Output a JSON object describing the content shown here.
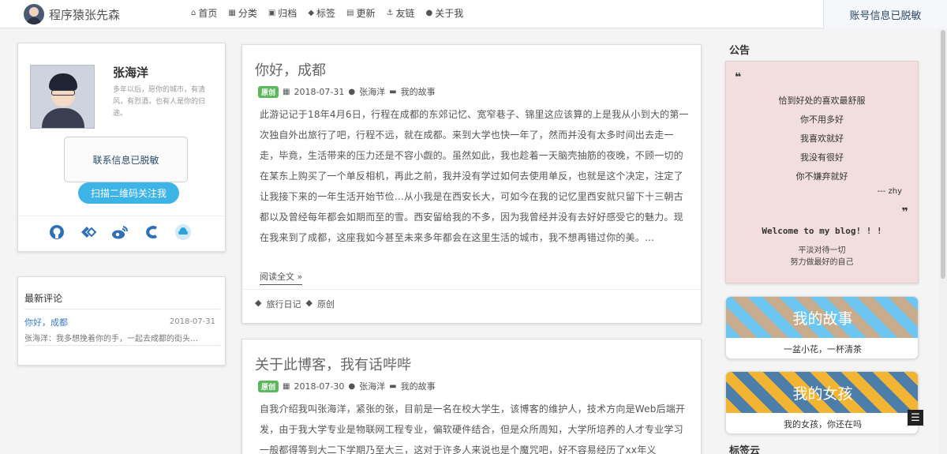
{
  "header": {
    "brand": "程序猿张先森",
    "nav": [
      {
        "icon": "home-icon",
        "glyph": "⌂",
        "label": "首页"
      },
      {
        "icon": "grid-icon",
        "glyph": "▦",
        "label": "分类"
      },
      {
        "icon": "archive-icon",
        "glyph": "▣",
        "label": "归档"
      },
      {
        "icon": "tags-icon",
        "glyph": "◆",
        "label": "标签"
      },
      {
        "icon": "calendar-plus-icon",
        "glyph": "▤",
        "label": "更新"
      },
      {
        "icon": "anchor-icon",
        "glyph": "⚓",
        "label": "友链"
      },
      {
        "icon": "user-icon",
        "glyph": "●",
        "label": "关于我"
      }
    ],
    "account": "账号信息已脱敏"
  },
  "profile": {
    "name": "张海洋",
    "bio": "多年以后，愿你的城市，有清风，有烈酒，也有人是你的归途。",
    "contact": "联系信息已脱敏",
    "qr_button": "扫描二维码关注我"
  },
  "comments": {
    "title": "最新评论",
    "items": [
      {
        "post": "你好，成都",
        "date": "2018-07-31",
        "text": "张海洋：我多想挽着你的手，一起去成都的街头…"
      }
    ]
  },
  "posts": [
    {
      "title": "你好，成都",
      "badge": "原创",
      "date": "2018-07-31",
      "author": "张海洋",
      "category": "我的故事",
      "excerpt": "此游记记于18年4月6日，行程在成都的东郊记忆、宽窄巷子、锦里这应该算的上是我从小到大的第一次独自外出旅行了吧，行程不远，就在成都。来到大学也快一年了，然而并没有太多时间出去走一走，毕竟，生活带来的压力还是不容小觑的。虽然如此，我也趁着一天脑壳抽筋的夜晚，不顾一切的在某东上购买了一个单反相机，再此之前，我并没有学过如何去使用单反，也就是这个决定，注定了让我接下来的一年生活开始节俭…从小我是在西安长大，可如今在我的记忆里西安就只留下十三朝古都以及曾经每年都会如期而至的雪。西安留给我的不多，因为我曾经并没有去好好感受它的魅力。现在我来到了成都，这座我如今甚至未来多年都会在这里生活的城市，我不想再错过你的美。...",
      "read_more": "阅读全文 »",
      "tags": [
        "旅行日记",
        "原创"
      ]
    },
    {
      "title": "关于此博客，我有话哔哔",
      "badge": "原创",
      "date": "2018-07-30",
      "author": "张海洋",
      "category": "我的故事",
      "excerpt": "自我介绍我叫张海洋，紧张的张，目前是一名在校大学生，该博客的维护人，技术方向是Web后端开发，由于我大学专业是物联网工程专业，偏软硬件结合，但是众所周知，大学所培养的人才专业学习一般都得等到大二下学期乃至大三，这对于许多人来说也是个魔咒吧，好不容易经历了xx年义"
    }
  ],
  "notice": {
    "heading": "公告",
    "quote_lines": [
      "恰到好处的喜欢最舒服",
      "你不用多好",
      "我喜欢就好",
      "我没有很好",
      "你不嫌弃就好"
    ],
    "author": "--- zhy",
    "welcome": "Welcome to my blog! ! !",
    "motto_1": "平淡对待一切",
    "motto_2": "努力做最好的自己"
  },
  "features": [
    {
      "title": "我的故事",
      "subtitle": "一盆小花，一杯清茶"
    },
    {
      "title": "我的女孩",
      "subtitle": "我的女孩，你还在吗"
    }
  ],
  "tagcloud_heading": "标签云",
  "scroll_glyph": "☰"
}
